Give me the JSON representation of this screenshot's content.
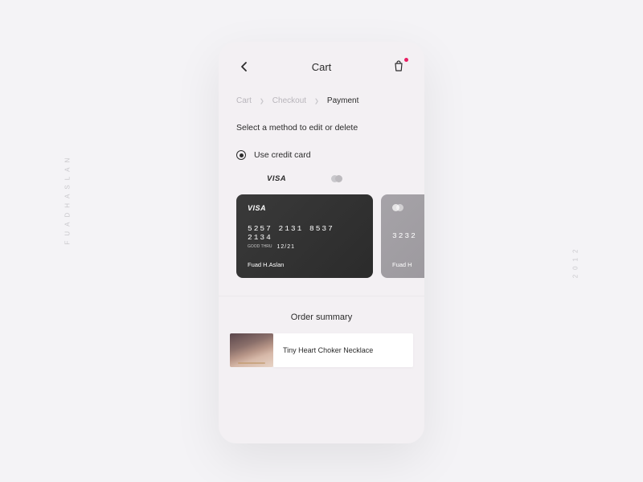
{
  "watermarks": {
    "left": "FUADHASLAN",
    "right": "2012"
  },
  "header": {
    "title": "Cart"
  },
  "breadcrumbs": {
    "items": [
      "Cart",
      "Checkout",
      "Payment"
    ],
    "active_index": 2
  },
  "instruction": "Select a method to edit or delete",
  "payment_option": {
    "label": "Use credit card",
    "selected": true
  },
  "card_tabs": {
    "visa": "VISA"
  },
  "cards": [
    {
      "brand": "VISA",
      "number": "5257 2131 8537 2134",
      "good_thru": "GOOD\nTHRU",
      "exp": "12/21",
      "name": "Fuad H.Aslan"
    },
    {
      "brand": "mc",
      "number": "3232",
      "name": "Fuad H"
    }
  ],
  "summary": {
    "title": "Order summary"
  },
  "product": {
    "name": "Tiny Heart Choker Necklace"
  }
}
